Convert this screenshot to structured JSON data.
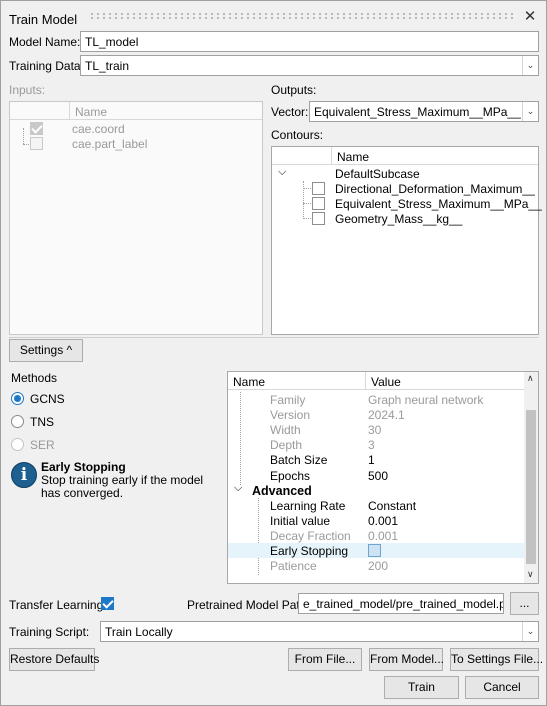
{
  "window": {
    "title": "Train Model",
    "close_icon": "close-icon"
  },
  "model_name": {
    "label": "Model Name:",
    "value": "TL_model"
  },
  "training_data": {
    "label": "Training Data:",
    "value": "TL_train"
  },
  "inputs": {
    "label": "Inputs:",
    "column": "Name",
    "items": [
      {
        "name": "cae.coord",
        "checked": true
      },
      {
        "name": "cae.part_label",
        "checked": false
      }
    ]
  },
  "outputs": {
    "label": "Outputs:",
    "vector_label": "Vector:",
    "vector_value": "Equivalent_Stress_Maximum__MPa__",
    "contours_label": "Contours:",
    "column": "Name",
    "group": "DefaultSubcase",
    "items": [
      "Directional_Deformation_Maximum__mm_",
      "Equivalent_Stress_Maximum__MPa__",
      "Geometry_Mass__kg__"
    ]
  },
  "settings": {
    "toggle_label": "Settings ^"
  },
  "methods": {
    "label": "Methods",
    "options": [
      {
        "label": "GCNS",
        "selected": true,
        "enabled": true
      },
      {
        "label": "TNS",
        "selected": false,
        "enabled": true
      },
      {
        "label": "SER",
        "selected": false,
        "enabled": false
      }
    ]
  },
  "info": {
    "title": "Early Stopping",
    "text": "Stop training early if the model has converged."
  },
  "props": {
    "col_name": "Name",
    "col_value": "Value",
    "rows": [
      {
        "name": "Family",
        "value": "Graph neural network",
        "state": "disabled"
      },
      {
        "name": "Version",
        "value": "2024.1",
        "state": "disabled"
      },
      {
        "name": "Width",
        "value": "30",
        "state": "disabled"
      },
      {
        "name": "Depth",
        "value": "3",
        "state": "disabled"
      },
      {
        "name": "Batch Size",
        "value": "1",
        "state": "normal"
      },
      {
        "name": "Epochs",
        "value": "500",
        "state": "normal"
      }
    ],
    "advanced_label": "Advanced",
    "adv_rows": [
      {
        "name": "Learning Rate",
        "value": "Constant",
        "state": "normal"
      },
      {
        "name": "Initial value",
        "value": "0.001",
        "state": "normal"
      },
      {
        "name": "Decay Fraction",
        "value": "0.001",
        "state": "disabled"
      },
      {
        "name": "Early Stopping",
        "value": "",
        "state": "checkbox"
      },
      {
        "name": "Patience",
        "value": "200",
        "state": "disabled"
      }
    ]
  },
  "transfer": {
    "label": "Transfer Learning:",
    "checked": true,
    "pretrained_label": "Pretrained Model Path:",
    "pretrained_value": "e_trained_model/pre_trained_model.psmdl",
    "browse": "..."
  },
  "training_script": {
    "label": "Training Script:",
    "value": "Train Locally"
  },
  "buttons": {
    "restore": "Restore Defaults",
    "from_file": "From File...",
    "from_model": "From Model...",
    "to_settings": "To Settings File...",
    "train": "Train",
    "cancel": "Cancel"
  }
}
